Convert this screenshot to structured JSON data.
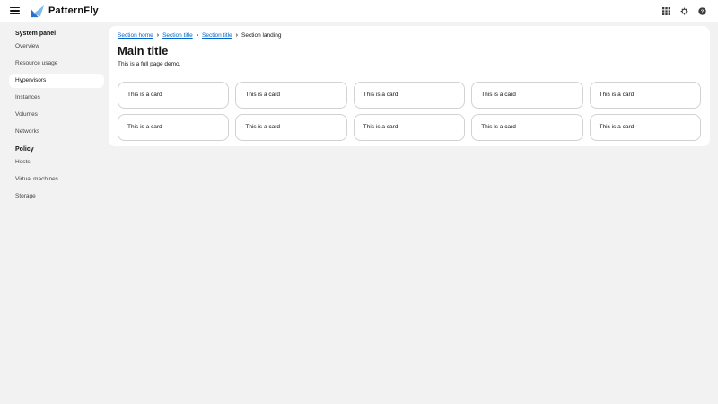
{
  "masthead": {
    "brand": "PatternFly",
    "menu_icon": "hamburger-menu",
    "action_icons": [
      "app-launcher-grid",
      "settings-gear",
      "help-question"
    ]
  },
  "sidebar": {
    "groups": [
      {
        "label": "System panel",
        "items": [
          {
            "label": "Overview",
            "selected": false
          },
          {
            "label": "Resource usage",
            "selected": false
          },
          {
            "label": "Hypervisors",
            "selected": true
          },
          {
            "label": "Instances",
            "selected": false
          },
          {
            "label": "Volumes",
            "selected": false
          },
          {
            "label": "Networks",
            "selected": false
          }
        ]
      },
      {
        "label": "Policy",
        "items": [
          {
            "label": "Hosts",
            "selected": false
          },
          {
            "label": "Virtual machines",
            "selected": false
          },
          {
            "label": "Storage",
            "selected": false
          }
        ]
      }
    ]
  },
  "breadcrumb": {
    "separator": "›",
    "items": [
      {
        "label": "Section home",
        "type": "link"
      },
      {
        "label": "Section title",
        "type": "link"
      },
      {
        "label": "Section title",
        "type": "link"
      },
      {
        "label": "Section landing",
        "type": "current"
      }
    ]
  },
  "main": {
    "title": "Main title",
    "subtitle": "This is a full page demo.",
    "cards": [
      "This is a card",
      "This is a card",
      "This is a card",
      "This is a card",
      "This is a card",
      "This is a card",
      "This is a card",
      "This is a card",
      "This is a card",
      "This is a card"
    ]
  },
  "colors": {
    "link_blue": "#0066cc",
    "page_background": "#f2f2f2",
    "panel_white": "#ffffff",
    "card_border": "#d2d2d2",
    "text": "#151515",
    "logo_dark_blue": "#2970cc",
    "logo_light_blue": "#7fb9e8"
  }
}
